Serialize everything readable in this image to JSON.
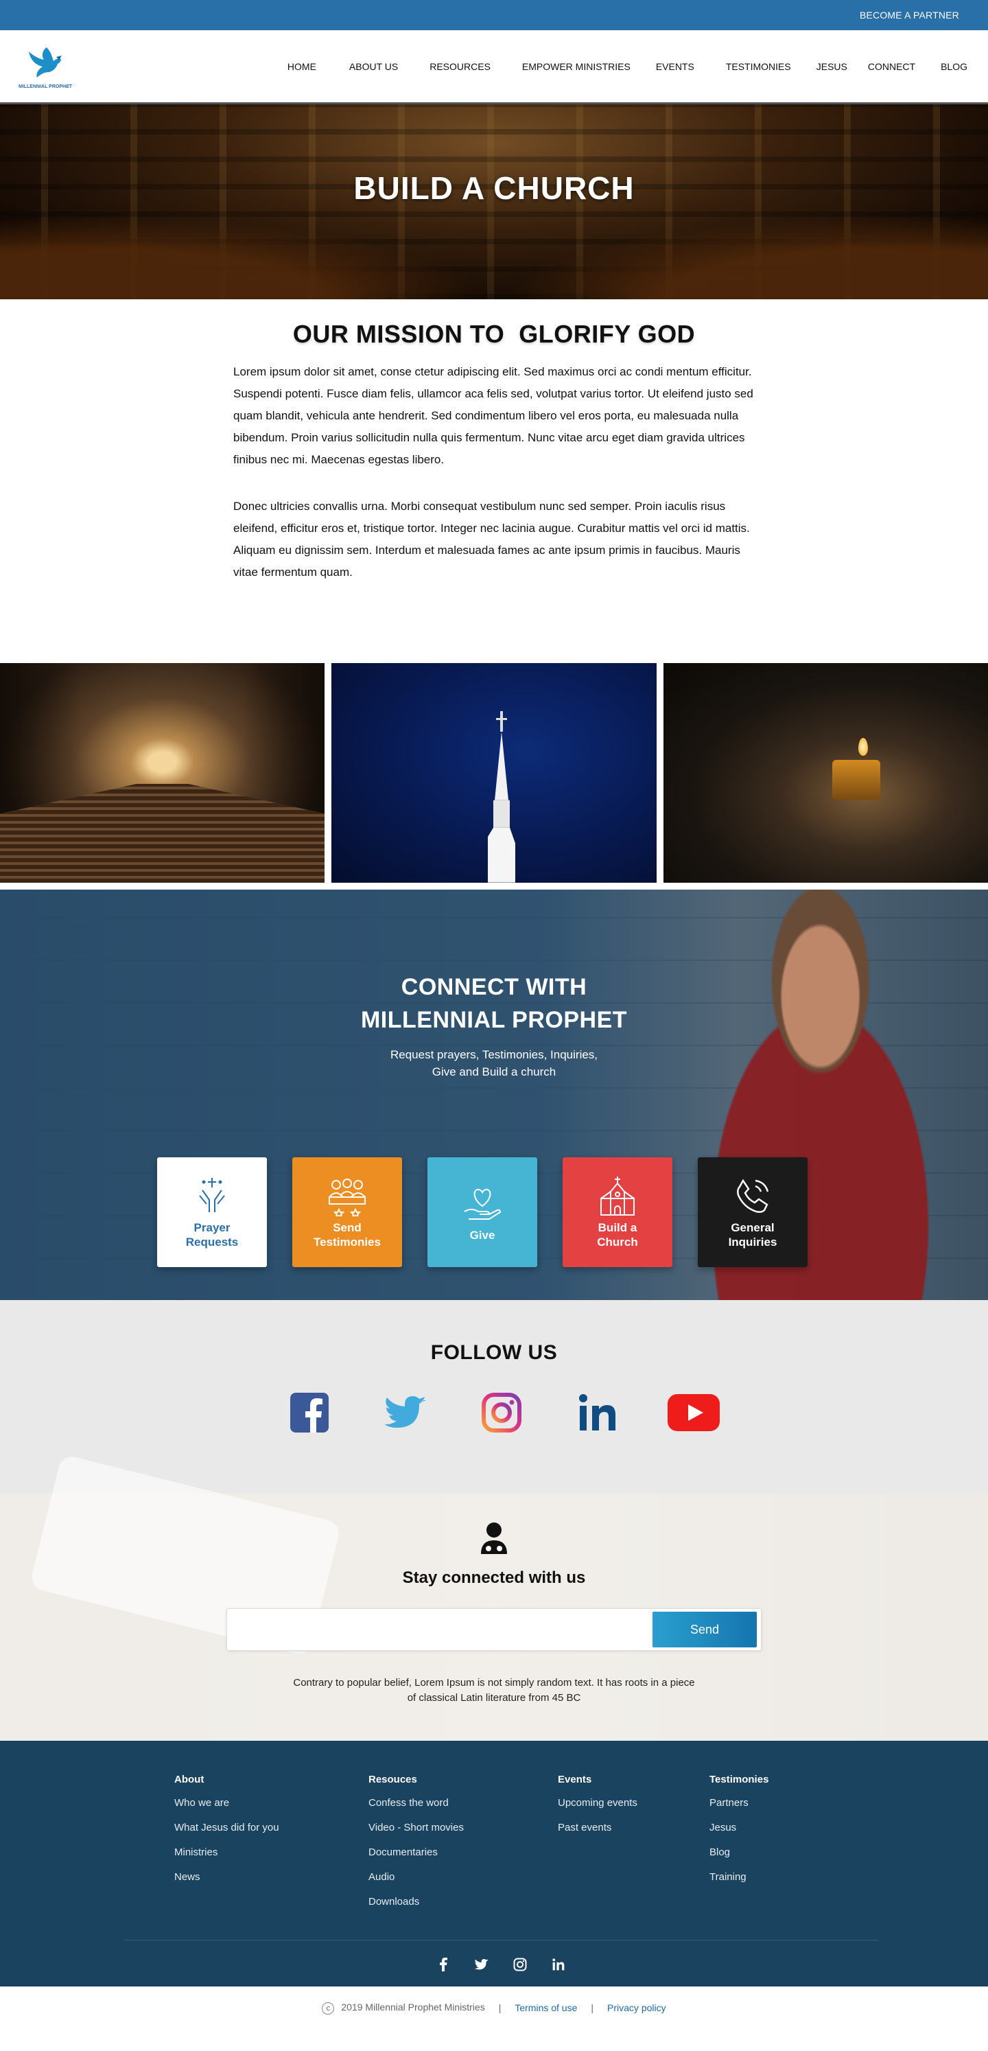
{
  "topbar": {
    "partner": "BECOME A PARTNER"
  },
  "logo": {
    "text": "MILLENNIAL PROPHET"
  },
  "nav": [
    "HOME",
    "ABOUT US",
    "RESOURCES",
    "EMPOWER MINISTRIES",
    "EVENTS",
    "TESTIMONIES",
    "JESUS",
    "CONNECT",
    "BLOG"
  ],
  "hero": {
    "title": "BUILD A CHURCH"
  },
  "mission": {
    "title": "OUR MISSION TO  GLORIFY GOD",
    "p1": "Lorem ipsum dolor sit amet, conse ctetur adipiscing elit. Sed maximus orci ac condi mentum efficitur. Suspendi potenti. Fusce diam felis, ullamcor aca felis sed, volutpat varius tortor. Ut eleifend justo sed quam blandit, vehicula ante hendrerit. Sed condimentum libero vel eros porta, eu malesuada nulla bibendum. Proin varius sollicitudin nulla quis fermentum. Nunc vitae arcu eget diam gravida ultrices finibus nec mi. Maecenas egestas libero.",
    "p2": "Donec ultricies convallis urna. Morbi consequat vestibulum nunc sed semper. Proin iaculis risus eleifend, efficitur eros et, tristique tortor. Integer nec lacinia augue. Curabitur mattis vel orci id mattis. Aliquam eu dignissim sem. Interdum et malesuada fames ac ante ipsum primis in faucibus. Mauris vitae fermentum quam."
  },
  "connect": {
    "title1": "CONNECT WITH",
    "title2": "MILLENNIAL PROPHET",
    "sub1": "Request prayers, Testimonies, Inquiries,",
    "sub2": "Give and Build a church",
    "cards": [
      {
        "l1": "Prayer",
        "l2": "Requests",
        "icon": "praying-hands-icon",
        "color": "#ffffff"
      },
      {
        "l1": "Send",
        "l2": "Testimonies",
        "icon": "group-icon",
        "color": "#ec8e22"
      },
      {
        "l1": "Give",
        "l2": "",
        "icon": "heart-hand-icon",
        "color": "#46b5d4"
      },
      {
        "l1": "Build a",
        "l2": "Church",
        "icon": "church-icon",
        "color": "#e44143"
      },
      {
        "l1": "General",
        "l2": "Inquiries",
        "icon": "phone-icon",
        "color": "#1b1b1b"
      }
    ]
  },
  "follow": {
    "title": "FOLLOW US",
    "icons": [
      "facebook-icon",
      "twitter-icon",
      "instagram-icon",
      "linkedin-icon",
      "youtube-icon"
    ]
  },
  "newsletter": {
    "title": "Stay connected with us",
    "input_placeholder": "",
    "send": "Send",
    "text1": "Contrary to popular belief, Lorem Ipsum is not simply random text. It has roots in a piece",
    "text2": "of classical Latin literature from 45 BC"
  },
  "footer": {
    "cols": [
      {
        "title": "About",
        "links": [
          "Who we are",
          "What Jesus did for you",
          "Ministries",
          "News"
        ]
      },
      {
        "title": "Resouces",
        "links": [
          "Confess the word",
          "Video - Short movies",
          "Documentaries",
          "Audio",
          "Downloads"
        ]
      },
      {
        "title": "Events",
        "links": [
          "Upcoming events",
          "Past events"
        ]
      },
      {
        "title": "Testimonies",
        "links": [
          "Partners",
          "Jesus",
          "Blog",
          "Training"
        ]
      }
    ],
    "social_icons": [
      "facebook-icon",
      "twitter-icon",
      "instagram-icon",
      "linkedin-icon"
    ]
  },
  "bottom": {
    "copyright_symbol": "c",
    "copyright": "2019 Millennial Prophet Ministries",
    "sep": "|",
    "terms": "Termins of use",
    "privacy": "Privacy policy"
  },
  "colors": {
    "primary": "#2a70a8",
    "footer": "#19435f",
    "orange": "#ec8e22",
    "teal": "#46b5d4",
    "red": "#e44143"
  }
}
